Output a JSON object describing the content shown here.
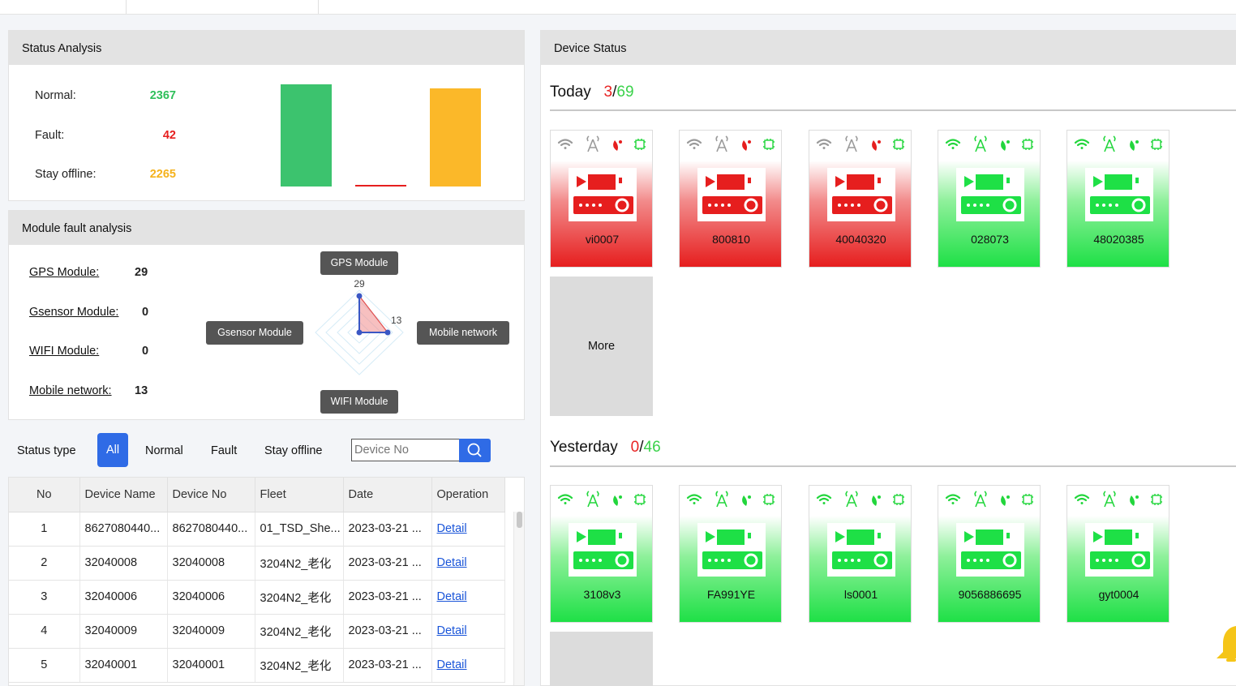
{
  "status_analysis": {
    "title": "Status Analysis",
    "rows": [
      {
        "label": "Normal:",
        "value": "2367",
        "color": "#2ebf5a"
      },
      {
        "label": "Fault:",
        "value": "42",
        "color": "#e61e1e"
      },
      {
        "label": "Stay offline:",
        "value": "2265",
        "color": "#f5b21d"
      }
    ],
    "bars": [
      {
        "value": 2367,
        "color": "#3cc36e"
      },
      {
        "value": 42,
        "color": "#e61e1e"
      },
      {
        "value": 2265,
        "color": "#fbb829"
      }
    ]
  },
  "module_fault": {
    "title": "Module fault analysis",
    "rows": [
      {
        "label": "GPS Module:",
        "value": "29"
      },
      {
        "label": "Gsensor Module:",
        "value": "0"
      },
      {
        "label": "WIFI Module:",
        "value": "0"
      },
      {
        "label": "Mobile network:",
        "value": "13"
      }
    ],
    "radar_labels": {
      "top": "GPS Module",
      "left": "Gsensor Module",
      "right": "Mobile network",
      "bottom": "WIFI Module"
    },
    "radar_values": {
      "top": "29",
      "right": "13"
    }
  },
  "filter": {
    "status_type_label": "Status type",
    "buttons": [
      "All",
      "Normal",
      "Fault",
      "Stay offline"
    ],
    "active": "All",
    "search_placeholder": "Device No"
  },
  "table": {
    "columns": [
      "No",
      "Device Name",
      "Device No",
      "Fleet",
      "Date",
      "Operation"
    ],
    "rows": [
      {
        "no": "1",
        "name": "8627080440...",
        "device_no": "8627080440...",
        "fleet": "01_TSD_She...",
        "date": "2023-03-21 ...",
        "op": "Detail"
      },
      {
        "no": "2",
        "name": "32040008",
        "device_no": "32040008",
        "fleet": "3204N2_老化",
        "date": "2023-03-21 ...",
        "op": "Detail"
      },
      {
        "no": "3",
        "name": "32040006",
        "device_no": "32040006",
        "fleet": "3204N2_老化",
        "date": "2023-03-21 ...",
        "op": "Detail"
      },
      {
        "no": "4",
        "name": "32040009",
        "device_no": "32040009",
        "fleet": "3204N2_老化",
        "date": "2023-03-21 ...",
        "op": "Detail"
      },
      {
        "no": "5",
        "name": "32040001",
        "device_no": "32040001",
        "fleet": "3204N2_老化",
        "date": "2023-03-21 ...",
        "op": "Detail"
      }
    ]
  },
  "device_status": {
    "title": "Device Status",
    "today": {
      "label": "Today",
      "fault": "3",
      "total": "69",
      "sep": "/"
    },
    "yesterday": {
      "label": "Yesterday",
      "fault": "0",
      "total": "46",
      "sep": "/"
    },
    "today_devices": [
      {
        "name": "vi0007",
        "state": "fault"
      },
      {
        "name": "800810",
        "state": "fault"
      },
      {
        "name": "40040320",
        "state": "fault"
      },
      {
        "name": "028073",
        "state": "normal"
      },
      {
        "name": "48020385",
        "state": "normal"
      }
    ],
    "yesterday_devices": [
      {
        "name": "3108v3",
        "state": "normal"
      },
      {
        "name": "FA991YE",
        "state": "normal"
      },
      {
        "name": "ls0001",
        "state": "normal"
      },
      {
        "name": "9056886695",
        "state": "normal"
      },
      {
        "name": "gyt0004",
        "state": "normal"
      }
    ],
    "more_label": "More",
    "colors": {
      "fault": "#e61e1e",
      "normal": "#1ee046",
      "icon_on": "#22d63c",
      "icon_off": "#9a9a9a",
      "icon_red": "#e61e1e"
    }
  }
}
